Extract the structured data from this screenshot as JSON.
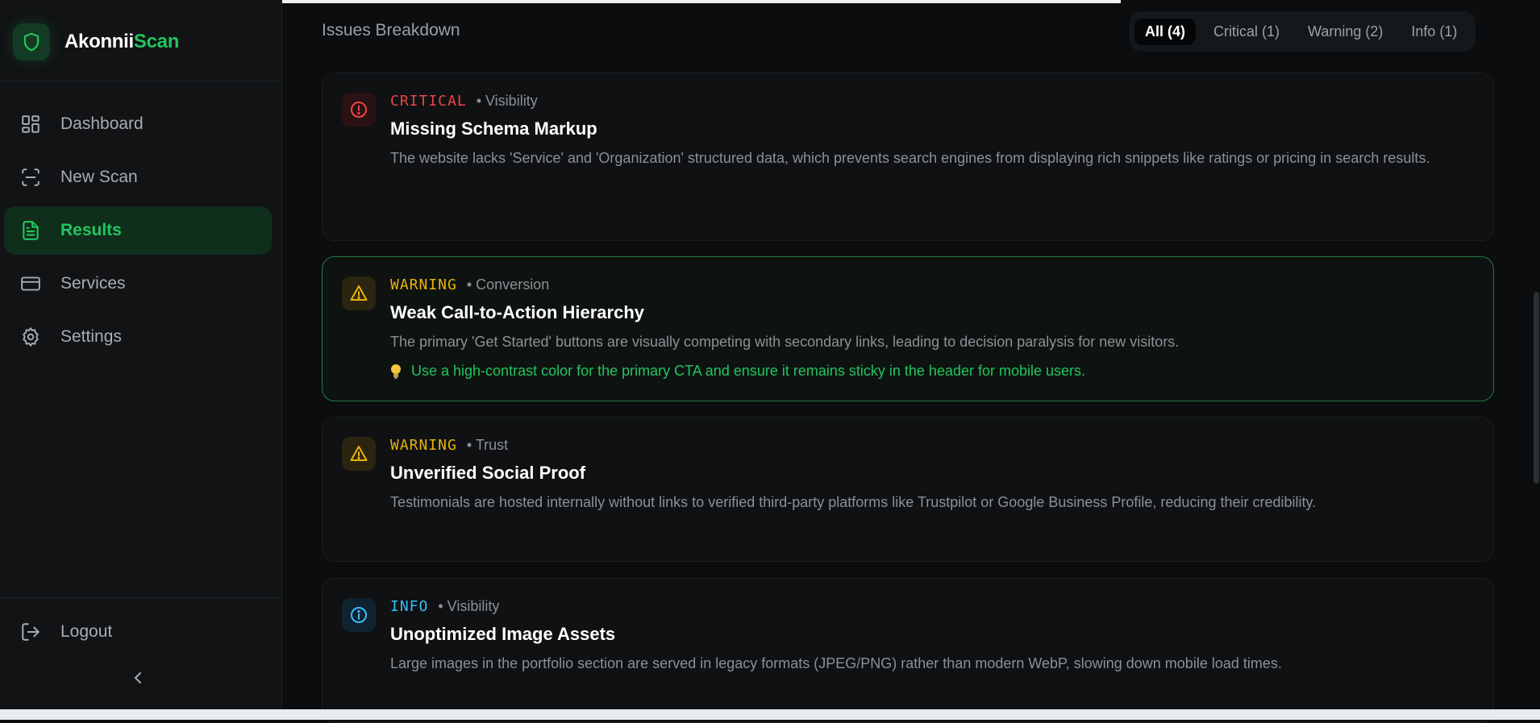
{
  "brand": {
    "name_part1": "Akonnii",
    "name_part2": "Scan",
    "accent": "#22c55e"
  },
  "sidebar": {
    "items": [
      {
        "label": "Dashboard",
        "icon": "dashboard-grid-icon",
        "active": false
      },
      {
        "label": "New Scan",
        "icon": "scan-frame-icon",
        "active": false
      },
      {
        "label": "Results",
        "icon": "document-icon",
        "active": true
      },
      {
        "label": "Services",
        "icon": "card-icon",
        "active": false
      },
      {
        "label": "Settings",
        "icon": "gear-icon",
        "active": false
      }
    ],
    "logout_label": "Logout",
    "collapse_icon": "chevron-left-icon"
  },
  "main": {
    "section_title": "Issues Breakdown",
    "filters": [
      {
        "label": "All (4)",
        "active": true
      },
      {
        "label": "Critical (1)",
        "active": false
      },
      {
        "label": "Warning (2)",
        "active": false
      },
      {
        "label": "Info (1)",
        "active": false
      }
    ],
    "issues": [
      {
        "severity": "CRITICAL",
        "category": "• Visibility",
        "title": "Missing Schema Markup",
        "description": "The website lacks 'Service' and 'Organization' structured data, which prevents search engines from displaying rich snippets like ratings or pricing in search results.",
        "color": "#ef4444",
        "icon": "alert-circle-icon"
      },
      {
        "severity": "WARNING",
        "category": "• Conversion",
        "title": "Weak Call-to-Action Hierarchy",
        "description": "The primary 'Get Started' buttons are visually competing with secondary links, leading to decision paralysis for new visitors.",
        "recommendation": "Use a high-contrast color for the primary CTA and ensure it remains sticky in the header for mobile users.",
        "color": "#eab308",
        "icon": "warning-triangle-icon"
      },
      {
        "severity": "WARNING",
        "category": "• Trust",
        "title": "Unverified Social Proof",
        "description": "Testimonials are hosted internally without links to verified third-party platforms like Trustpilot or Google Business Profile, reducing their credibility.",
        "color": "#eab308",
        "icon": "warning-triangle-icon"
      },
      {
        "severity": "INFO",
        "category": "• Visibility",
        "title": "Unoptimized Image Assets",
        "description": "Large images in the portfolio section are served in legacy formats (JPEG/PNG) rather than modern WebP, slowing down mobile load times.",
        "color": "#38bdf8",
        "icon": "info-circle-icon"
      }
    ]
  }
}
